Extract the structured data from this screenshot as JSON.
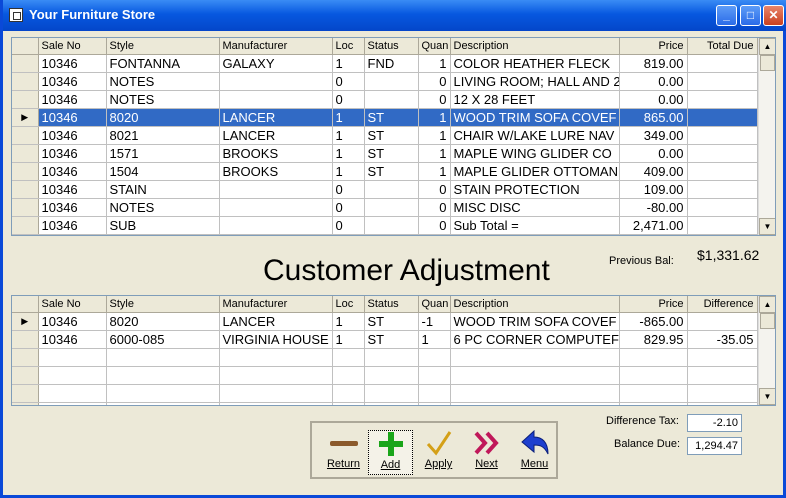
{
  "window": {
    "title": "Your Furniture Store"
  },
  "columns": [
    "Sale No",
    "Style",
    "Manufacturer",
    "Loc",
    "Status",
    "Quan",
    "Description",
    "Price",
    "Total Due"
  ],
  "sales_rows": [
    [
      "10346",
      "FONTANNA",
      "GALAXY",
      "1",
      "FND",
      "1",
      "COLOR  HEATHER FLECK",
      "819.00",
      ""
    ],
    [
      "10346",
      "NOTES",
      "",
      "0",
      "",
      "0",
      "LIVING ROOM; HALL AND 2",
      "0.00",
      ""
    ],
    [
      "10346",
      "NOTES",
      "",
      "0",
      "",
      "0",
      "12 X 28 FEET",
      "0.00",
      ""
    ],
    [
      "10346",
      "8020",
      "LANCER",
      "1",
      "ST",
      "1",
      "WOOD TRIM SOFA COVEF",
      "865.00",
      ""
    ],
    [
      "10346",
      "8021",
      "LANCER",
      "1",
      "ST",
      "1",
      "CHAIR W/LAKE LURE NAV",
      "349.00",
      ""
    ],
    [
      "10346",
      "1571",
      "BROOKS",
      "1",
      "ST",
      "1",
      "MAPLE WING GLIDER  CO",
      "0.00",
      ""
    ],
    [
      "10346",
      "1504",
      "BROOKS",
      "1",
      "ST",
      "1",
      "MAPLE GLIDER OTTOMAN",
      "409.00",
      ""
    ],
    [
      "10346",
      "STAIN",
      "",
      "0",
      "",
      "0",
      "STAIN PROTECTION",
      "109.00",
      ""
    ],
    [
      "10346",
      "NOTES",
      "",
      "0",
      "",
      "0",
      "MISC DISC",
      "-80.00",
      ""
    ],
    [
      "10346",
      "SUB",
      "",
      "0",
      "",
      "0",
      "Sub Total =",
      "2,471.00",
      ""
    ]
  ],
  "sales_selected_row": 3,
  "adjustment": {
    "heading": "Customer Adjustment",
    "previous_bal_label": "Previous Bal:",
    "previous_bal_value": "$1,331.62",
    "columns": [
      "Sale No",
      "Style",
      "Manufacturer",
      "Loc",
      "Status",
      "Quan",
      "Description",
      "Price",
      "Difference"
    ],
    "rows": [
      [
        "10346",
        "8020",
        "LANCER",
        "1",
        "ST",
        "-1",
        "WOOD TRIM SOFA COVEF",
        "-865.00",
        ""
      ],
      [
        "10346",
        "6000-085",
        "VIRGINIA HOUSE",
        "1",
        "ST",
        "1",
        "6 PC CORNER COMPUTEF",
        "829.95",
        "-35.05"
      ],
      [
        "",
        "",
        "",
        "",
        "",
        "",
        "",
        "",
        ""
      ],
      [
        "",
        "",
        "",
        "",
        "",
        "",
        "",
        "",
        ""
      ],
      [
        "",
        "",
        "",
        "",
        "",
        "",
        "",
        "",
        ""
      ],
      [
        "",
        "",
        "",
        "",
        "",
        "",
        "",
        "",
        ""
      ]
    ],
    "difference_tax_label": "Difference Tax:",
    "difference_tax_value": "-2.10",
    "balance_due_label": "Balance Due:",
    "balance_due_value": "1,294.47"
  },
  "buttons": [
    {
      "label": "Return",
      "icon": "minus-bar-icon",
      "color": "#8b5a2b"
    },
    {
      "label": "Add",
      "icon": "plus-icon",
      "color": "#1aa51a"
    },
    {
      "label": "Apply",
      "icon": "checkmark-icon",
      "color": "#d4a017"
    },
    {
      "label": "Next",
      "icon": "double-chevron-right-icon",
      "color": "#c0185a"
    },
    {
      "label": "Menu",
      "icon": "back-arrow-icon",
      "color": "#1d3fcf"
    }
  ]
}
